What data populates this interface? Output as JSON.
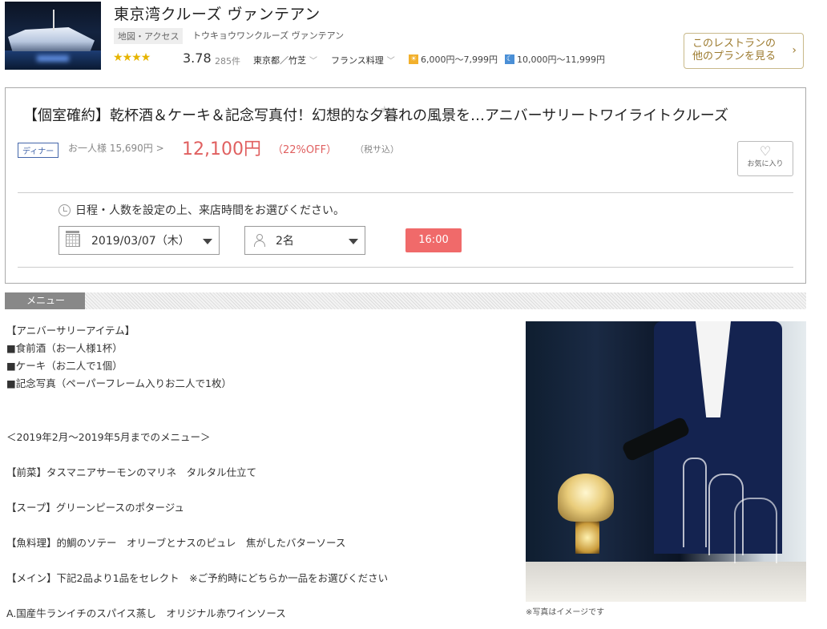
{
  "header": {
    "restaurant_name": "東京湾クルーズ ヴァンテアン",
    "map_tag": "地図・アクセス",
    "yomi": "トウキョウワンクルーズ ヴァンテアン",
    "rating_stars": 4,
    "rating_score": "3.78",
    "review_count": "285件",
    "area": "東京都／竹芝",
    "genre": "フランス料理",
    "lunch_price": "6,000円～7,999円",
    "dinner_price": "10,000円～11,999円",
    "other_plans_line1": "このレストランの",
    "other_plans_line2": "他のプランを見る"
  },
  "plan": {
    "title": "【個室確約】乾杯酒＆ケーキ＆記念写真付！幻想的な夕暮れの風景を…アニバーサリートワイライトクルーズ",
    "meal_badge": "ディナー",
    "original_price": "お一人様 15,690円",
    "sale_price": "12,100円",
    "discount": "（22%OFF）",
    "tax_note": "（税サ込）",
    "favorite_label": "お気に入り",
    "instruction": "日程・人数を設定の上、来店時間をお選びください。",
    "date_value": "2019/03/07（木）",
    "people_value": "2名",
    "time_button": "16:00"
  },
  "menu": {
    "section_label": "メニュー",
    "lines": [
      "【アニバーサリーアイテム】",
      "■食前酒（お一人様1杯）",
      "■ケーキ（お二人で1個）",
      "■記念写真（ペーパーフレーム入りお二人で1枚）",
      "＜2019年2月～2019年5月までのメニュー＞",
      "【前菜】タスマニアサーモンのマリネ　タルタル仕立て",
      "【スープ】グリーンピースのポタージュ",
      "【魚料理】的鯛のソテー　オリーブとナスのピュレ　焦がしたバターソース",
      "【メイン】下記2品より1品をセレクト　※ご予約時にどちらか一品をお選びください",
      "A.国産牛ランイチのスパイス蒸し　オリジナル赤ワインソース"
    ],
    "photo_caption": "※写真はイメージです"
  },
  "colors": {
    "sale_red": "#e06060",
    "time_button_bg": "#f06a6a",
    "star_gold": "#e6b400",
    "gold_border": "#c9b98a"
  }
}
